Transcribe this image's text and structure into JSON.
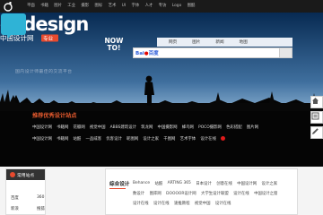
{
  "nav": {
    "items": [
      "平面",
      "书籍",
      "图片",
      "工业",
      "摄影",
      "图标",
      "艺术",
      "UI",
      "字体",
      "人才",
      "专访",
      "Logo",
      "图酷"
    ]
  },
  "brand": {
    "name": "cndesign",
    "cn_name": "中国设计网",
    "badge": "专业",
    "slogan": "国内设计师最佳的交流平台"
  },
  "howto": {
    "label": "NOW TO!"
  },
  "search": {
    "engine": "Bai",
    "engine_suffix": "百度",
    "tabs": [
      "网页",
      "图片",
      "新闻",
      "地图"
    ],
    "value": ""
  },
  "recommend": {
    "title": "推荐优秀设计站点",
    "row1": [
      "中国设计网",
      "书籍网",
      "花瓣网",
      "视觉中国",
      "ABBS建筑设计",
      "筑龙网",
      "中国摄影网",
      "蜂鸟网",
      "POCO摄影网",
      "色彩搭配",
      "图片网"
    ],
    "row2": [
      "中国设计网",
      "书籍网",
      "站酷",
      "一品威客",
      "优客设计",
      "昵图网",
      "设计之家",
      "千图网",
      "艺术字体",
      "设计在线"
    ],
    "row3": [
      "Behance",
      "站酷",
      "ARTING 365",
      "日本设计网",
      "创意在线",
      "中国设计网",
      "设计之家",
      "视觉中国",
      "设计在线"
    ]
  },
  "common": {
    "title": "常用站点",
    "rows": [
      {
        "label": "百度",
        "value": "360"
      },
      {
        "label": "新浪",
        "value": "搜狐"
      }
    ]
  },
  "main": {
    "title": "综合设计",
    "row1": [
      "Behance",
      "站酷",
      "ARTING 365",
      "日本设计",
      "创意在线",
      "中国设计网",
      "设计之家",
      "视觉中国",
      "设计在线"
    ],
    "row2": [
      "数设计",
      "图库网",
      "DOOOOR设计网",
      "大学生设计联盟",
      "设计在线",
      "设计在线",
      "设计在线",
      "中国设计之窗",
      "速推教程"
    ],
    "row3": []
  },
  "float_tools": [
    "home-icon",
    "list-icon",
    "edit-icon"
  ],
  "colors": {
    "accent": "#e84a2e",
    "nav_bg": "#1a1a1a",
    "sky_top": "#0a3a6e",
    "sky_mid": "#5a88b8"
  }
}
